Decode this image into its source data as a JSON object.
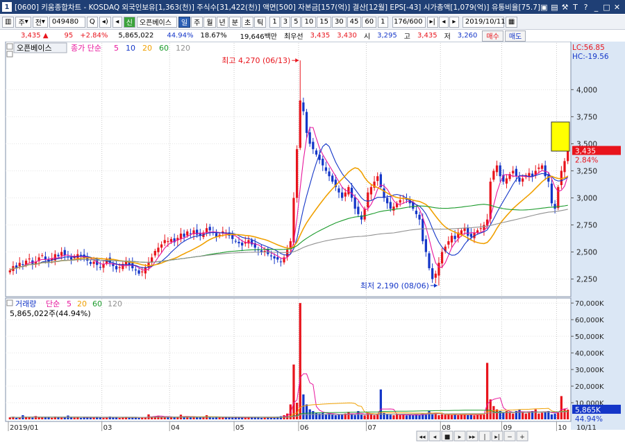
{
  "window": {
    "title": "[0600] 키움종합차트 - KOSDAQ 외국인보유[1,363(천)] 주식수[31,422(천)] 액면[500] 자본금[157(억)] 결산[12월] EPS[-43] 시가총액[1,079(억)] 유통비율[75.7]",
    "logo": "1",
    "icons": [
      "lock-icon",
      "grid-icon",
      "tools-icon",
      "T",
      "help-icon",
      "minimize-icon",
      "maximize-icon",
      "close-icon"
    ],
    "icon_glyphs": [
      "▣",
      "▤",
      "⚒",
      "T",
      "?",
      "_",
      "□",
      "✕"
    ]
  },
  "toolbar": {
    "menu_btn": "▥",
    "type_label": "주",
    "dropdown_glyph": "▾",
    "jeon_label": "전",
    "code": "049480",
    "search_glyph": "Q",
    "sound_glyph": "◂)",
    "prev_glyph": "◂",
    "sin_label": "신",
    "stock_name": "오픈베이스",
    "periods": [
      "일",
      "주",
      "월",
      "년",
      "분",
      "초",
      "틱"
    ],
    "active_period": "일",
    "intervals": [
      "1",
      "3",
      "5",
      "10",
      "15",
      "30",
      "45",
      "60"
    ],
    "extra_btn": "1",
    "count": "176/600",
    "nav_glyphs": [
      "▸|",
      "◂",
      "▸"
    ],
    "date": "2019/10/11",
    "calendar_glyph": "▦"
  },
  "quote": {
    "price": "3,435",
    "up_arrow": "▲",
    "change": "95",
    "change_pct": "+2.84%",
    "volume": "5,865,022",
    "vol_ratio": "44.94%",
    "turnover": "18.67%",
    "amount": "19,646백만",
    "best_label": "최우선",
    "ask": "3,435",
    "bid": "3,430",
    "open_label": "시",
    "open": "3,295",
    "high_label": "고",
    "high": "3,435",
    "low_label": "저",
    "low": "3,260",
    "buy_label": "매수",
    "sell_label": "매도"
  },
  "price_panel": {
    "name": "오픈베이스",
    "ma_label": "종가 단순",
    "ma_periods": [
      "5",
      "10",
      "20",
      "60",
      "120"
    ],
    "lc": "LC:56.85",
    "hc": "HC:-19.56",
    "current_price": "3,435",
    "current_pct": "2.84%",
    "high_annot": "최고 4,270 (06/13)",
    "low_annot": "최저 2,190 (08/06)"
  },
  "volume_panel": {
    "name": "거래량",
    "ma_label": "단순",
    "ma_periods": [
      "5",
      "20",
      "60",
      "120"
    ],
    "volume_text": "5,865,022주(44.94%)",
    "current_volume": "5,865K",
    "current_pct": "44.94%"
  },
  "x_axis": {
    "labels": [
      "2019/01",
      "03",
      "04",
      "05",
      "06",
      "07",
      "08",
      "09",
      "10",
      "10/11"
    ]
  },
  "bottom_controls": {
    "glyphs": [
      "◂◂",
      "◂",
      "■",
      "▸",
      "▸▸",
      "|",
      "▸|",
      "−",
      "+"
    ]
  },
  "colors": {
    "up": "#e8141c",
    "down": "#1436c8",
    "ma5": "#e8149c",
    "ma10": "#1436c8",
    "ma20": "#f0a000",
    "ma60": "#1a9a2a",
    "ma120": "#909090"
  },
  "chart_data": [
    {
      "type": "candlestick",
      "title": "오픈베이스",
      "y_ticks": [
        2250,
        2500,
        2750,
        3000,
        3250,
        3500,
        3750,
        4000
      ],
      "ylim": [
        2100,
        4380
      ],
      "x_months": [
        "2019/01",
        "03",
        "04",
        "05",
        "06",
        "07",
        "08",
        "09",
        "10"
      ],
      "closes": [
        2330,
        2370,
        2350,
        2400,
        2380,
        2420,
        2440,
        2390,
        2410,
        2450,
        2470,
        2430,
        2410,
        2440,
        2480,
        2460,
        2500,
        2470,
        2450,
        2430,
        2460,
        2480,
        2470,
        2440,
        2420,
        2390,
        2410,
        2380,
        2360,
        2390,
        2430,
        2400,
        2370,
        2340,
        2360,
        2390,
        2410,
        2380,
        2350,
        2330,
        2300,
        2320,
        2360,
        2400,
        2450,
        2510,
        2540,
        2570,
        2610,
        2600,
        2620,
        2590,
        2630,
        2670,
        2640,
        2690,
        2670,
        2700,
        2660,
        2650,
        2680,
        2720,
        2700,
        2680,
        2640,
        2660,
        2690,
        2680,
        2650,
        2620,
        2600,
        2580,
        2560,
        2590,
        2610,
        2570,
        2540,
        2520,
        2500,
        2510,
        2480,
        2460,
        2440,
        2430,
        2410,
        2450,
        2520,
        2600,
        3000,
        3450,
        3900,
        3800,
        3600,
        3500,
        3450,
        3400,
        3350,
        3300,
        3250,
        3200,
        3150,
        3100,
        3050,
        3000,
        3050,
        3100,
        3000,
        2900,
        2850,
        2800,
        2900,
        3050,
        3100,
        3150,
        3200,
        3100,
        3000,
        2950,
        2900,
        2920,
        2950,
        2980,
        3000,
        2980,
        2950,
        2900,
        2850,
        2800,
        2600,
        2500,
        2350,
        2250,
        2300,
        2400,
        2500,
        2550,
        2600,
        2650,
        2620,
        2680,
        2700,
        2720,
        2650,
        2640,
        2680,
        2700,
        2720,
        2750,
        2800,
        3150,
        3250,
        3300,
        3200,
        3150,
        3180,
        3220,
        3250,
        3200,
        3150,
        3180,
        3210,
        3230,
        3200,
        3250,
        3280,
        3300,
        3200,
        3150,
        2950,
        2900,
        3100,
        3250,
        3340,
        3435
      ],
      "high": 4270,
      "low": 2190
    },
    {
      "type": "bar",
      "title": "거래량",
      "y_ticks": [
        10000,
        20000,
        30000,
        40000,
        50000,
        60000,
        70000
      ],
      "y_tick_labels": [
        "10,000K",
        "20,000K",
        "30,000K",
        "40,000K",
        "50,000K",
        "60,000K",
        "70,000K"
      ],
      "ylim": [
        0,
        73000
      ],
      "values": [
        1200,
        1500,
        900,
        1100,
        2500,
        1400,
        1300,
        1000,
        2000,
        1200,
        1100,
        1500,
        1300,
        900,
        1700,
        1200,
        1000,
        1300,
        2300,
        1100,
        1000,
        1200,
        900,
        1400,
        1300,
        1000,
        1100,
        1500,
        1200,
        900,
        1000,
        1700,
        1300,
        1100,
        900,
        1200,
        1500,
        1000,
        1300,
        1100,
        900,
        1400,
        1200,
        3000,
        1500,
        1800,
        2200,
        1300,
        1600,
        1400,
        1200,
        1500,
        1300,
        2800,
        1700,
        1400,
        1200,
        1300,
        1500,
        1200,
        1100,
        2500,
        1300,
        1000,
        1200,
        1400,
        1100,
        1300,
        1200,
        1000,
        1100,
        1300,
        1000,
        900,
        1500,
        1200,
        1400,
        1100,
        900,
        1000,
        1200,
        1100,
        1300,
        1600,
        1900,
        2500,
        3500,
        9000,
        33000,
        10000,
        70000,
        15000,
        9000,
        6000,
        5000,
        4000,
        3500,
        4000,
        3000,
        3500,
        3000,
        2500,
        3000,
        2800,
        3500,
        4500,
        3000,
        2600,
        5000,
        2800,
        2400,
        4000,
        3000,
        2500,
        3500,
        18000,
        4000,
        3000,
        2800,
        2500,
        3200,
        2600,
        2800,
        2400,
        2600,
        2700,
        3000,
        2500,
        3500,
        2800,
        5000,
        3000,
        4000,
        2500,
        3000,
        2800,
        3200,
        2600,
        3000,
        2500,
        3000,
        2800,
        2600,
        3000,
        2400,
        2800,
        3200,
        3000,
        34000,
        12000,
        8000,
        6000,
        5000,
        4000,
        5000,
        4000,
        3500,
        5000,
        6000,
        4500,
        3500,
        4000,
        5000,
        6000,
        3500,
        4000,
        4500,
        5000,
        3000,
        3500,
        4000,
        14000,
        6500,
        5865
      ]
    }
  ]
}
